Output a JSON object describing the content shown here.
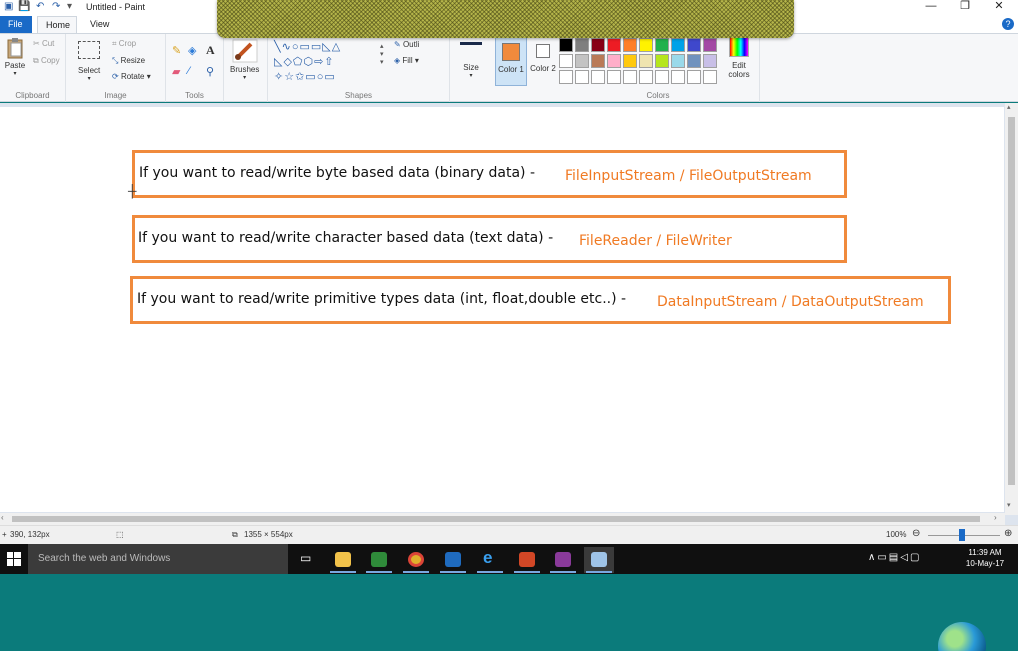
{
  "window": {
    "title": "Untitled - Paint"
  },
  "tabs": {
    "file": "File",
    "home": "Home",
    "view": "View"
  },
  "ribbon": {
    "clipboard": {
      "label": "Clipboard",
      "paste": "Paste",
      "cut": "Cut",
      "copy": "Copy"
    },
    "image": {
      "label": "Image",
      "select": "Select",
      "crop": "Crop",
      "resize": "Resize",
      "rotate": "Rotate"
    },
    "tools": {
      "label": "Tools"
    },
    "brushes": {
      "label": "Brushes"
    },
    "shapes": {
      "label": "Shapes",
      "outline": "Outli",
      "fill": "Fill"
    },
    "size": {
      "label": "Size"
    },
    "color1": {
      "label": "Color 1"
    },
    "color2": {
      "label": "Color 2"
    },
    "colors": {
      "label": "Colors",
      "edit": "Edit colors",
      "palette_row1": [
        "#000000",
        "#7f7f7f",
        "#880015",
        "#ed1c24",
        "#ff7f27",
        "#fff200",
        "#22b14c",
        "#00a2e8",
        "#3f48cc",
        "#a349a4"
      ],
      "palette_row2": [
        "#ffffff",
        "#c3c3c3",
        "#b97a57",
        "#ffaec9",
        "#ffc90e",
        "#efe4b0",
        "#b5e61d",
        "#99d9ea",
        "#7092be",
        "#c8bfe7"
      ]
    }
  },
  "canvas": {
    "rows": [
      {
        "question": "If you want to read/write byte based data (binary data)  - ",
        "answer": "FileInputStream / FileOutputStream"
      },
      {
        "question": "If you want to read/write character based data (text data) - ",
        "answer": "FileReader / FileWriter"
      },
      {
        "question": "If you want to read/write primitive types data (int, float,double etc..) - ",
        "answer": "DataInputStream / DataOutputStream"
      }
    ]
  },
  "statusbar": {
    "cursor": "390, 132px",
    "dimensions": "1355 × 554px",
    "zoom": "100%"
  },
  "taskbar": {
    "search_placeholder": "Search the web and Windows",
    "time": "11:39 AM",
    "date": "10-May-17"
  }
}
